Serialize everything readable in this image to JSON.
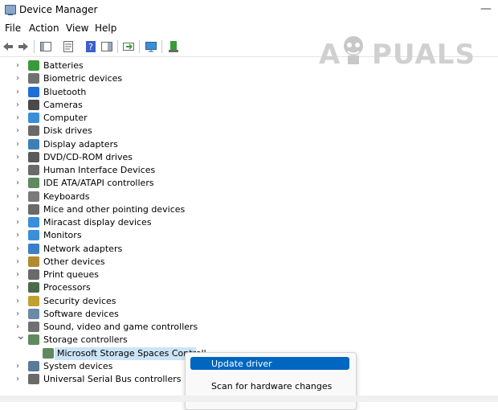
{
  "window": {
    "title": "Device Manager",
    "minimize_glyph": "—"
  },
  "menu": [
    "File",
    "Action",
    "View",
    "Help"
  ],
  "toolbar": {
    "icons": [
      "back-arrow-icon",
      "forward-arrow-icon",
      "console-tree-icon",
      "properties-icon",
      "help-icon",
      "action-pane-icon",
      "update-driver-icon",
      "monitor-icon",
      "uninstall-icon"
    ]
  },
  "watermark": {
    "left": "A",
    "right": "PUALS"
  },
  "tree": {
    "items": [
      {
        "label": "Batteries",
        "icon": "battery-icon",
        "color": "#3a9a3a",
        "expanded": false
      },
      {
        "label": "Biometric devices",
        "icon": "fingerprint-icon",
        "color": "#707070",
        "expanded": false
      },
      {
        "label": "Bluetooth",
        "icon": "bluetooth-icon",
        "color": "#1f6fd6",
        "expanded": false
      },
      {
        "label": "Cameras",
        "icon": "camera-icon",
        "color": "#4a4a4a",
        "expanded": false
      },
      {
        "label": "Computer",
        "icon": "computer-icon",
        "color": "#3a8fd8",
        "expanded": false
      },
      {
        "label": "Disk drives",
        "icon": "disk-drive-icon",
        "color": "#6a6a6a",
        "expanded": false
      },
      {
        "label": "Display adapters",
        "icon": "display-adapter-icon",
        "color": "#3f7fb8",
        "expanded": false
      },
      {
        "label": "DVD/CD-ROM drives",
        "icon": "dvd-drive-icon",
        "color": "#5a5a5a",
        "expanded": false
      },
      {
        "label": "Human Interface Devices",
        "icon": "hid-icon",
        "color": "#6a6a6a",
        "expanded": false
      },
      {
        "label": "IDE ATA/ATAPI controllers",
        "icon": "ide-controller-icon",
        "color": "#5f8a5f",
        "expanded": false
      },
      {
        "label": "Keyboards",
        "icon": "keyboard-icon",
        "color": "#7a7a7a",
        "expanded": false
      },
      {
        "label": "Mice and other pointing devices",
        "icon": "mouse-icon",
        "color": "#6a6a6a",
        "expanded": false
      },
      {
        "label": "Miracast display devices",
        "icon": "miracast-icon",
        "color": "#3a8fd8",
        "expanded": false
      },
      {
        "label": "Monitors",
        "icon": "monitor-icon",
        "color": "#3a8fd8",
        "expanded": false
      },
      {
        "label": "Network adapters",
        "icon": "network-adapter-icon",
        "color": "#3a7fc8",
        "expanded": false
      },
      {
        "label": "Other devices",
        "icon": "other-devices-icon",
        "color": "#b08a30",
        "expanded": false
      },
      {
        "label": "Print queues",
        "icon": "printer-icon",
        "color": "#6a6a6a",
        "expanded": false
      },
      {
        "label": "Processors",
        "icon": "processor-icon",
        "color": "#4a6a4a",
        "expanded": false
      },
      {
        "label": "Security devices",
        "icon": "security-device-icon",
        "color": "#c0a030",
        "expanded": false
      },
      {
        "label": "Software devices",
        "icon": "software-device-icon",
        "color": "#6a8aa8",
        "expanded": false
      },
      {
        "label": "Sound, video and game controllers",
        "icon": "speaker-icon",
        "color": "#707070",
        "expanded": false
      },
      {
        "label": "Storage controllers",
        "icon": "storage-controller-icon",
        "color": "#5f8a5f",
        "expanded": true
      },
      {
        "label": "Microsoft Storage Spaces Controll",
        "icon": "storage-controller-icon",
        "color": "#5f8a5f",
        "child": true,
        "selected": true
      },
      {
        "label": "System devices",
        "icon": "system-devices-icon",
        "color": "#5a7a9a",
        "expanded": false
      },
      {
        "label": "Universal Serial Bus controllers",
        "icon": "usb-icon",
        "color": "#6a6a6a",
        "expanded": false
      }
    ]
  },
  "context_menu": {
    "items": [
      {
        "label": "Update driver",
        "highlighted": true
      },
      {
        "label": "Scan for hardware changes",
        "highlighted": false
      }
    ]
  },
  "colors": {
    "selection": "#cce4f7",
    "menu_highlight": "#0067c0",
    "watermark": "#d0d0d0"
  }
}
